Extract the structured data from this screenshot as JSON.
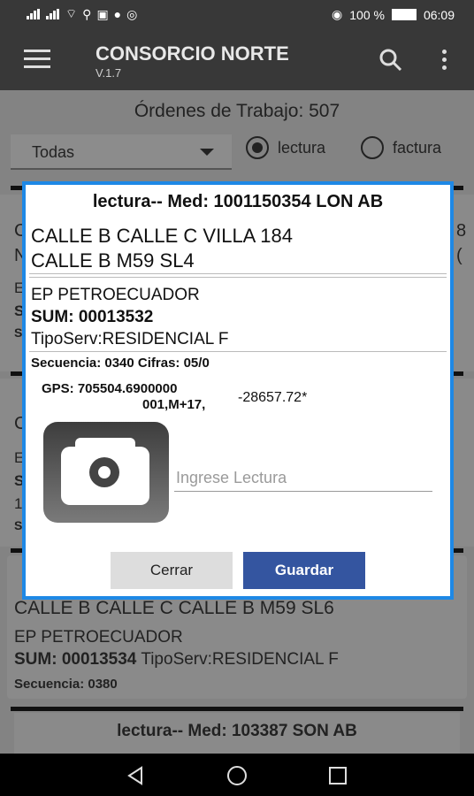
{
  "status_bar": {
    "battery": "100 %",
    "time": "06:09"
  },
  "app_bar": {
    "title": "CONSORCIO NORTE",
    "version": "V.1.7"
  },
  "main": {
    "orders_title": "Órdenes de Trabajo: 507",
    "filter_value": "Todas",
    "radio_lectura": "lectura",
    "radio_factura": "factura",
    "card_bottom": {
      "address": "CALLE B CALLE C CALLE B M59 SL6",
      "company": "EP PETROECUADOR",
      "sum": "SUM: 00013534",
      "tiposerv": "TipoServ:RESIDENCIAL F",
      "secuencia": "Secuencia: 0380"
    },
    "card_last_header": "lectura-- Med: 103387 SON AB",
    "bg_fragments": {
      "a": "C",
      "b": "N",
      "c": "E",
      "d": "S",
      "e": "S",
      "f": "C",
      "g": "E",
      "h": "S",
      "i": "1",
      "j": "S",
      "k": "8",
      "l": "("
    }
  },
  "dialog": {
    "header": "lectura-- Med: 1001150354 LON AB",
    "address_line1": "CALLE B CALLE C VILLA 184",
    "address_line2": "CALLE B M59 SL4",
    "company": "EP PETROECUADOR",
    "sum": "SUM: 00013532",
    "tiposerv": "TipoServ:RESIDENCIAL F",
    "secuencia": "Secuencia: 0340 Cifras: 05/0",
    "gps_line1": "GPS: 705504.6900000",
    "gps_line2": "001,M+17,",
    "gps_value": "-28657.72*",
    "input_placeholder": "Ingrese Lectura",
    "btn_cerrar": "Cerrar",
    "btn_guardar": "Guardar"
  }
}
